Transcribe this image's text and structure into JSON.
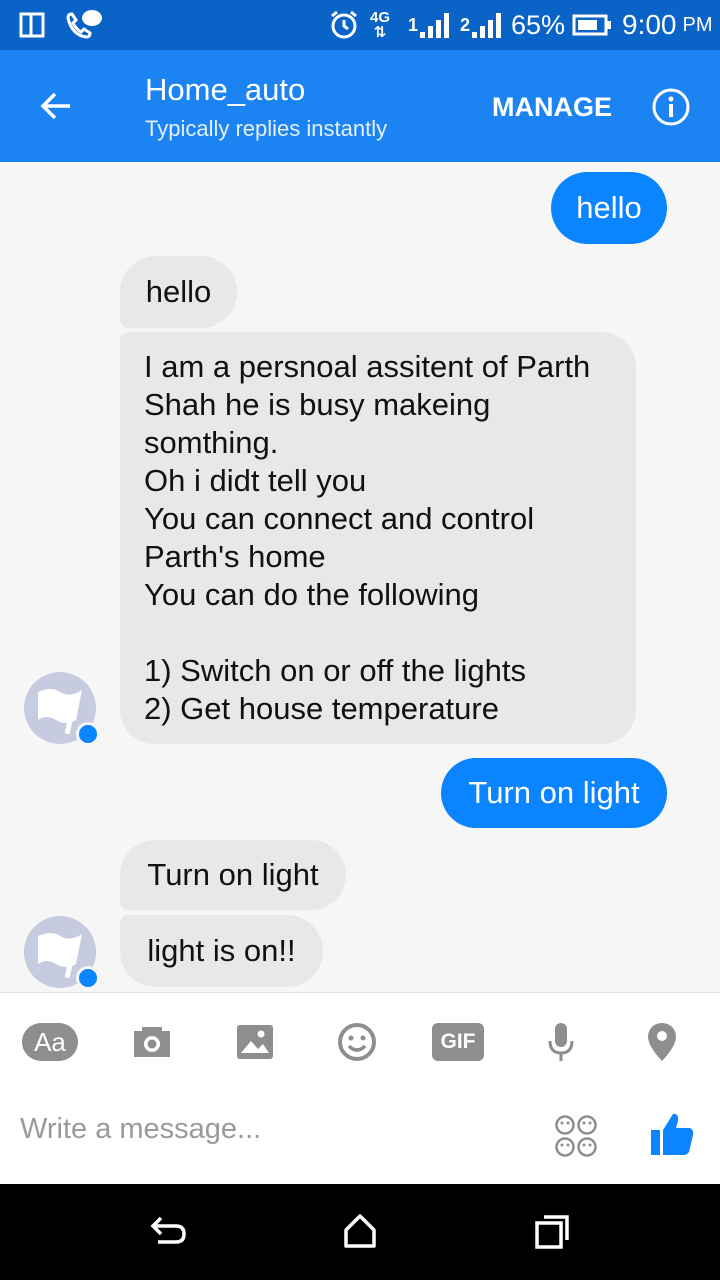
{
  "status_bar": {
    "network": "4G",
    "sim1": "1",
    "sim2": "2",
    "battery": "65%",
    "time": "9:00",
    "ampm": "PM"
  },
  "header": {
    "title": "Home_auto",
    "subtitle": "Typically replies instantly",
    "manage_label": "MANAGE"
  },
  "messages": [
    {
      "from": "me",
      "text": "hello"
    },
    {
      "from": "bot",
      "text": "hello"
    },
    {
      "from": "bot",
      "lines": [
        "I am a persnoal assitent of Parth",
        "Shah he is busy makeing",
        "somthing.",
        "Oh i didt tell you",
        "You can connect and control",
        "Parth's home",
        "You can do the following",
        "",
        "1) Switch on or off the lights",
        "2) Get house temperature"
      ]
    },
    {
      "from": "me",
      "text": "Turn on light"
    },
    {
      "from": "bot",
      "text": "Turn on light"
    },
    {
      "from": "bot",
      "text": "light is on!!"
    }
  ],
  "composer": {
    "placeholder": "Write a message...",
    "aa_label": "Aa",
    "gif_label": "GIF"
  },
  "colors": {
    "status_bar": "#0a63c6",
    "app_bar": "#1b84f2",
    "outgoing_bubble": "#0a84ff",
    "incoming_bubble": "#e8e8e8"
  }
}
